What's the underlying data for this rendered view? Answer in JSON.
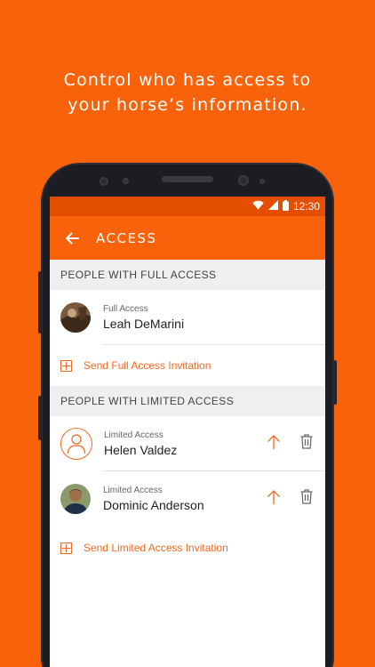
{
  "promo": {
    "line1": "Control who has access to",
    "line2": "your horse’s information."
  },
  "status_bar": {
    "time": "12:30"
  },
  "app_bar": {
    "title": "ACCESS",
    "back_icon": "arrow-left-icon"
  },
  "full_access": {
    "header": "PEOPLE WITH FULL ACCESS",
    "people": [
      {
        "kind": "Full Access",
        "name": "Leah DeMarini"
      }
    ],
    "invite_label": "Send Full Access Invitation"
  },
  "limited_access": {
    "header": "PEOPLE WITH LIMITED ACCESS",
    "people": [
      {
        "kind": "Limited Access",
        "name": "Helen Valdez"
      },
      {
        "kind": "Limited Access",
        "name": "Dominic Anderson"
      }
    ],
    "invite_label": "Send Limited Access Invitation"
  },
  "colors": {
    "brand": "#f8620a",
    "status_bar": "#e34e00",
    "accent": "#f06a25"
  }
}
